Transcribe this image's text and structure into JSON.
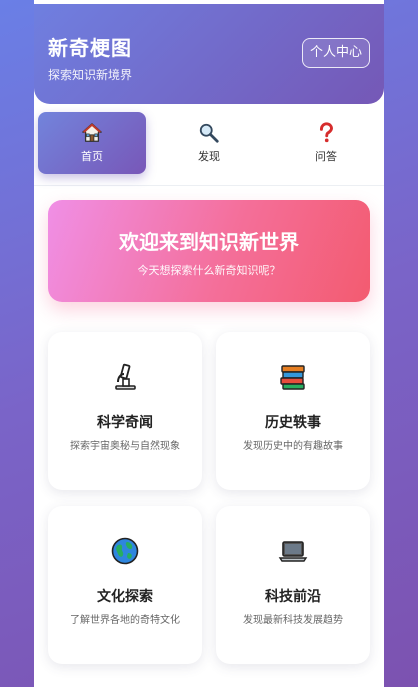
{
  "header": {
    "title": "新奇梗图",
    "subtitle": "探索知识新境界",
    "profile_label": "个人中心"
  },
  "nav": {
    "items": [
      {
        "label": "首页",
        "icon": "house-icon",
        "active": true
      },
      {
        "label": "发现",
        "icon": "magnifier-icon",
        "active": false
      },
      {
        "label": "问答",
        "icon": "question-mark-icon",
        "active": false
      }
    ]
  },
  "hero": {
    "title": "欢迎来到知识新世界",
    "subtitle": "今天想探索什么新奇知识呢？"
  },
  "cards": [
    {
      "title": "科学奇闻",
      "desc": "探索宇宙奥秘与自然现象",
      "icon": "microscope-icon"
    },
    {
      "title": "历史轶事",
      "desc": "发现历史中的有趣故事",
      "icon": "books-icon"
    },
    {
      "title": "文化探索",
      "desc": "了解世界各地的奇特文化",
      "icon": "globe-icon"
    },
    {
      "title": "科技前沿",
      "desc": "发现最新科技发展趋势",
      "icon": "laptop-icon"
    }
  ],
  "colors": {
    "header_gradient_start": "#6f7fe0",
    "header_gradient_end": "#7558b6",
    "hero_gradient_start": "#f08fe6",
    "hero_gradient_end": "#f35b70",
    "nav_active": "#7558b6"
  }
}
